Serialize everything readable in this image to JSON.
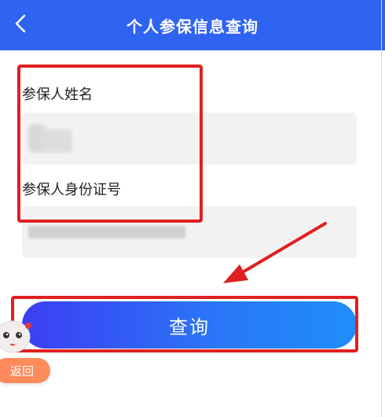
{
  "header": {
    "title": "个人参保信息查询",
    "back_icon": "chevron-left-icon"
  },
  "form": {
    "name_label": "参保人姓名",
    "name_value": "",
    "id_label": "参保人身份证号",
    "id_value": ""
  },
  "query_button": {
    "label": "查询"
  },
  "floating": {
    "return_label": "返回"
  },
  "colors": {
    "header_bg": "#2f63f2",
    "annotation_red": "#e02020",
    "return_bg": "#ff8a5c",
    "input_bg": "#f2f2f2"
  }
}
